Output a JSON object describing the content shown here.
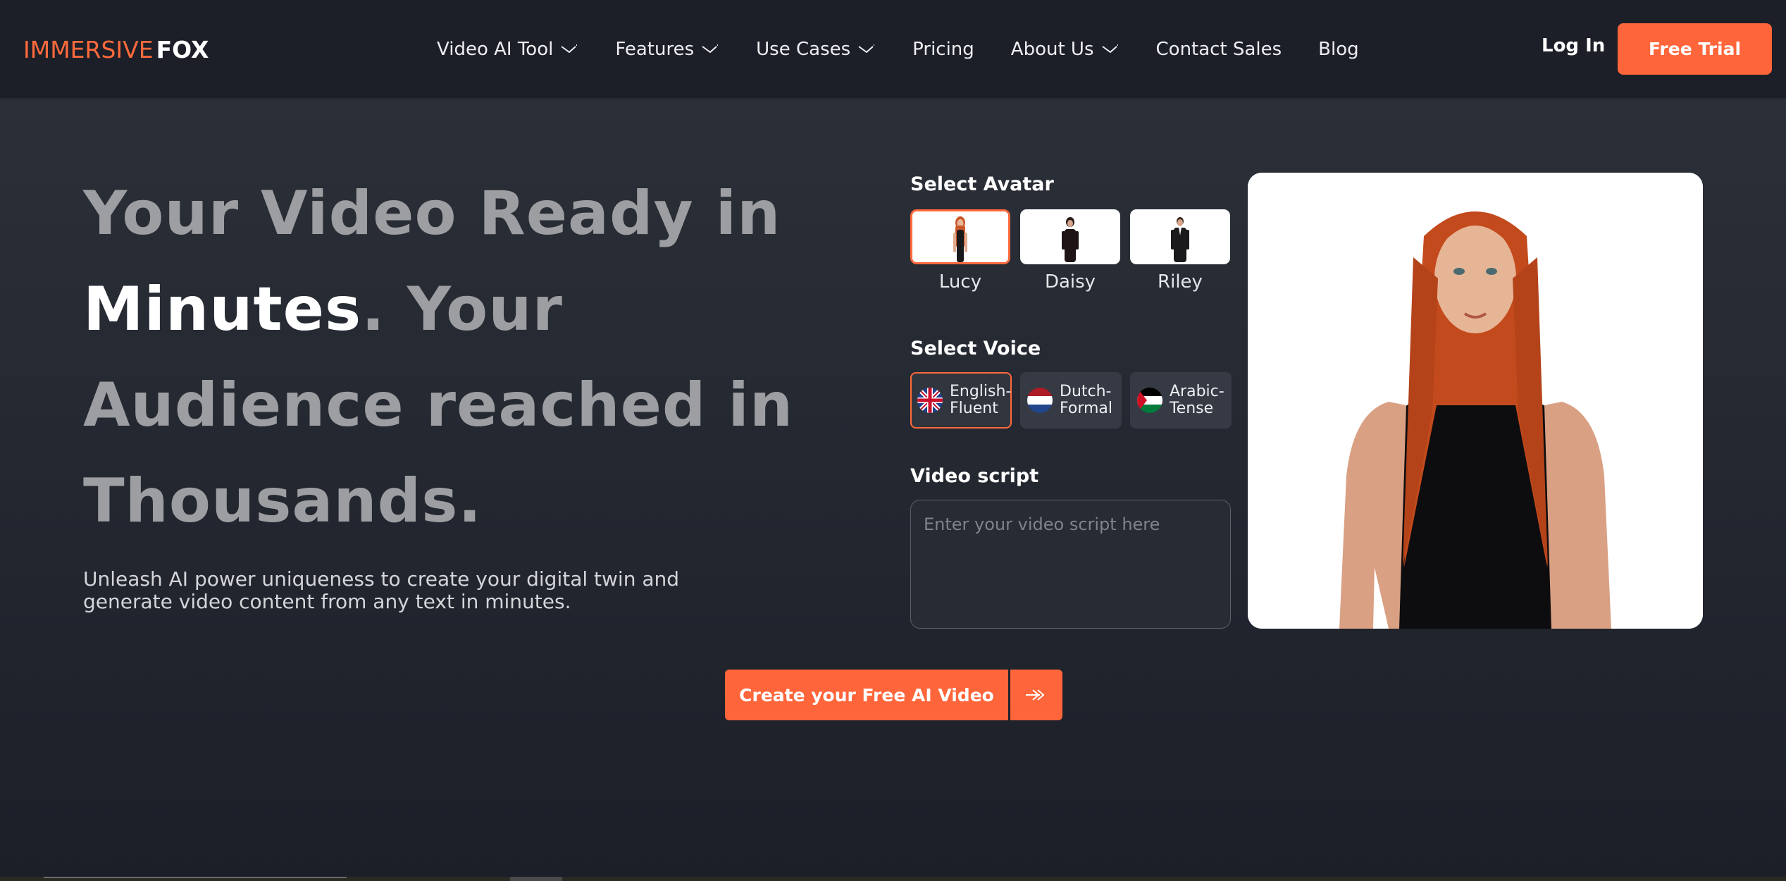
{
  "brand": {
    "name_part1": "IMMERSIVE",
    "name_part2": "FOX",
    "accent": "#ff653a"
  },
  "nav": {
    "items": [
      {
        "label": "Video AI Tool",
        "has_dropdown": true
      },
      {
        "label": "Features",
        "has_dropdown": true
      },
      {
        "label": "Use Cases",
        "has_dropdown": true
      },
      {
        "label": "Pricing",
        "has_dropdown": false
      },
      {
        "label": "About Us",
        "has_dropdown": true
      },
      {
        "label": "Contact Sales",
        "has_dropdown": false
      },
      {
        "label": "Blog",
        "has_dropdown": false
      }
    ],
    "login_label": "Log In",
    "free_trial_label": "Free Trial"
  },
  "hero": {
    "headline_part1": "Your Video Ready in ",
    "headline_highlight": "Minutes",
    "headline_part2": ". Your Audience reached in Thousands.",
    "subtitle": "Unleash AI power uniqueness to create your digital twin and generate video content from any text in minutes."
  },
  "builder": {
    "avatar_title": "Select Avatar",
    "avatars": [
      {
        "name": "Lucy",
        "selected": true
      },
      {
        "name": "Daisy",
        "selected": false
      },
      {
        "name": "Riley",
        "selected": false
      }
    ],
    "voice_title": "Select Voice",
    "voices": [
      {
        "line1": "English-",
        "line2": "Fluent",
        "flag": "uk-flag-icon",
        "selected": true
      },
      {
        "line1": "Dutch-",
        "line2": "Formal",
        "flag": "netherlands-flag-icon",
        "selected": false
      },
      {
        "line1": "Arabic-",
        "line2": "Tense",
        "flag": "arabic-flag-icon",
        "selected": false
      }
    ],
    "script_title": "Video script",
    "script_placeholder": "Enter your video script here",
    "script_value": ""
  },
  "cta": {
    "label": "Create your Free AI Video",
    "arrow_icon": "double-chevron-right-icon"
  }
}
